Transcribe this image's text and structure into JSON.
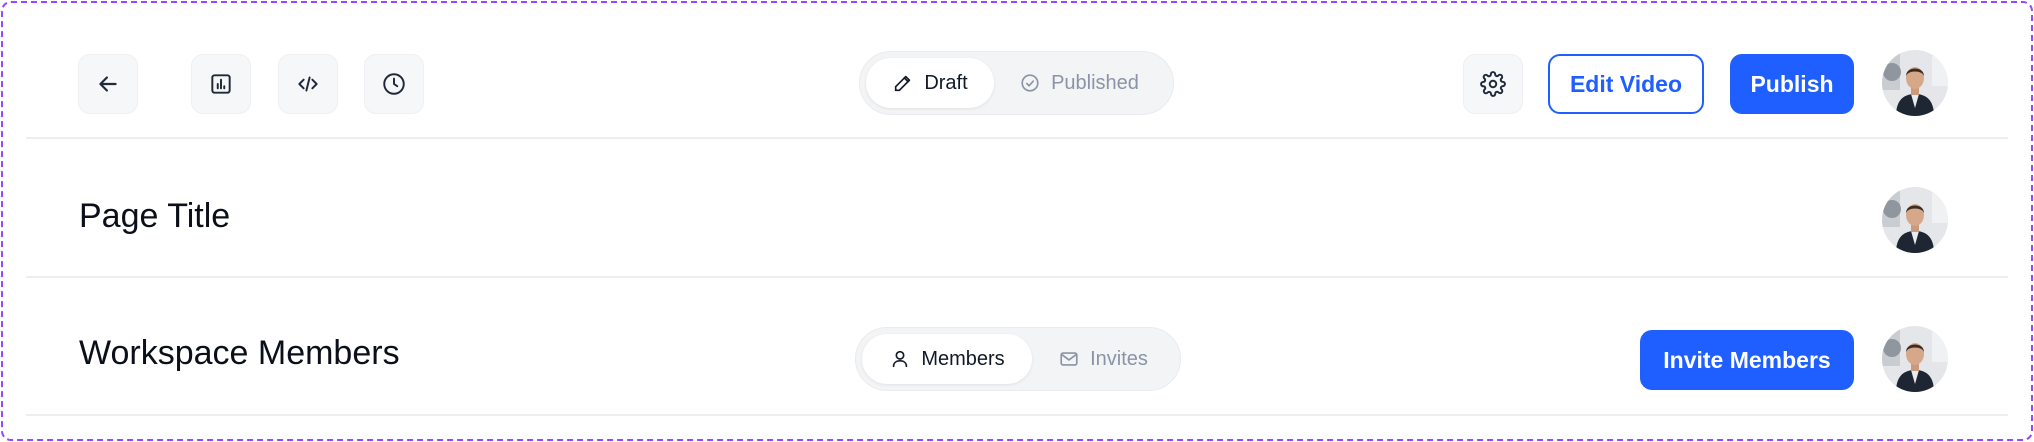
{
  "header": {
    "back_icon": "arrow-left-icon",
    "analytics_icon": "bar-chart-icon",
    "embed_icon": "code-icon",
    "history_icon": "clock-icon",
    "status_toggle": {
      "draft_label": "Draft",
      "published_label": "Published",
      "selected": "Draft"
    },
    "settings_icon": "gear-icon",
    "edit_video_label": "Edit Video",
    "publish_label": "Publish"
  },
  "page_header": {
    "title": "Page Title"
  },
  "workspace_header": {
    "title": "Workspace Members",
    "tabs": {
      "members_label": "Members",
      "invites_label": "Invites",
      "selected": "Members"
    },
    "invite_label": "Invite Members"
  },
  "colors": {
    "primary": "#1f5eff",
    "border_dashed": "#9747ff",
    "muted_text": "#8a94a6"
  }
}
